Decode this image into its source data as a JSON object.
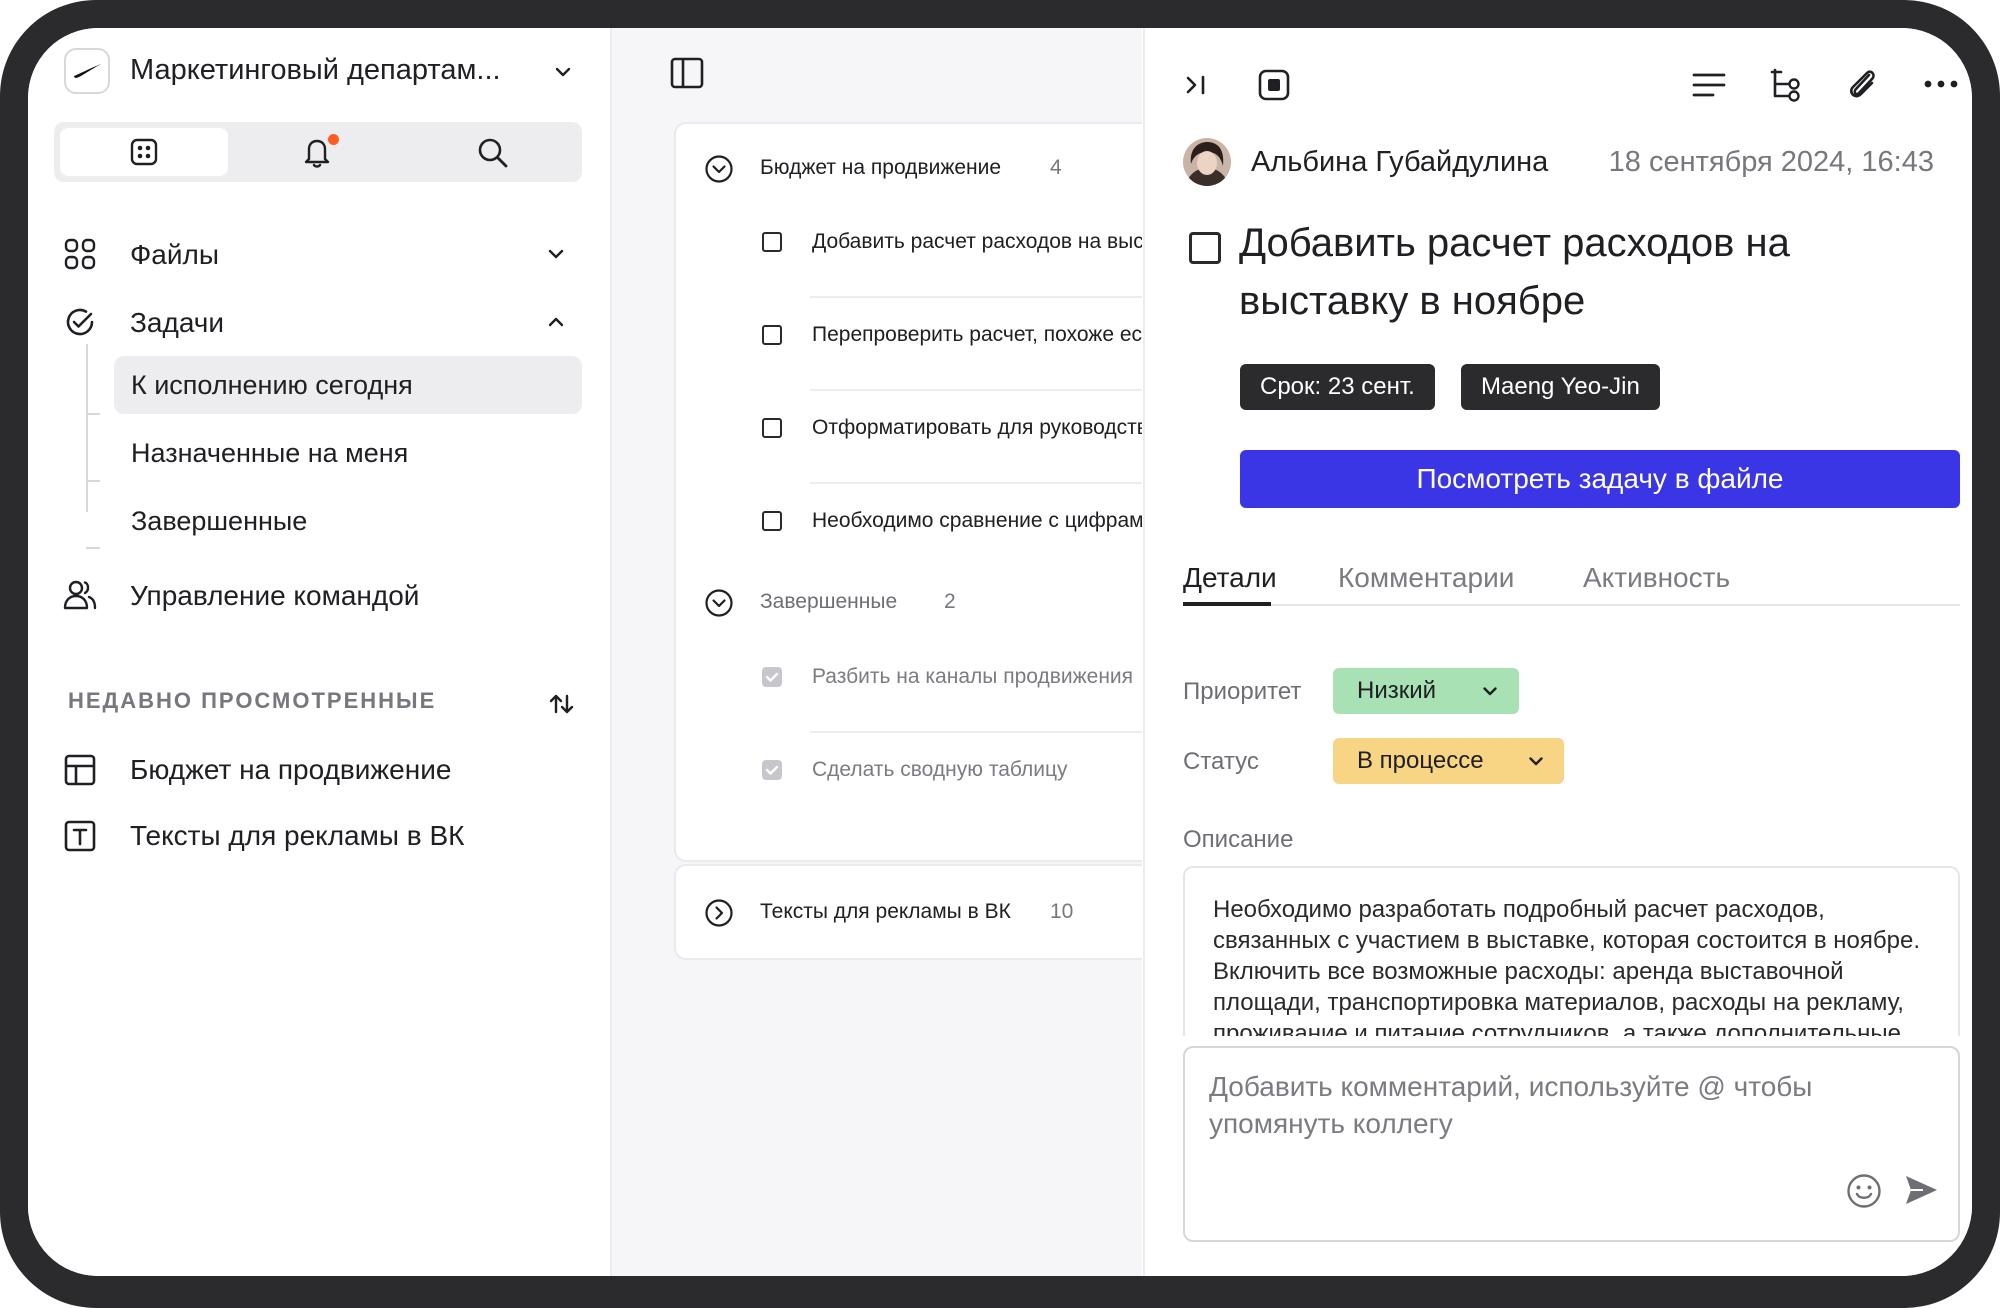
{
  "workspace": {
    "name": "Маркетинговый департам...",
    "logo": "swoosh-logo"
  },
  "tabs_switch": {
    "items": [
      "grid-icon",
      "bell-icon",
      "search-icon"
    ],
    "active": 0,
    "accent": "#ff5a1f"
  },
  "sidebar": {
    "files": "Файлы",
    "tasks": "Задачи",
    "task_subitems": [
      "К исполнению сегодня",
      "Назначенные на меня",
      "Завершенные"
    ],
    "team": "Управление командой",
    "recent_title": "НЕДАВНО ПРОСМОТРЕННЫЕ",
    "recent": [
      {
        "label": "Бюджет на продвижение",
        "icon": "table-icon"
      },
      {
        "label": "Тексты для рекламы в ВК",
        "icon": "text-doc-icon"
      }
    ]
  },
  "task_list": {
    "groups": [
      {
        "name": "Бюджет на продвижение",
        "count": "4",
        "expanded": true,
        "tasks": [
          "Добавить расчет расходов на выставку в ноябре",
          "Перепроверить расчет, похоже есть ошибка",
          "Отформатировать для руководства",
          "Необходимо сравнение с цифрами прошлого года"
        ]
      },
      {
        "name": "Завершенные",
        "count": "2",
        "expanded": true,
        "tasks": [
          "Разбить на каналы продвижения",
          "Сделать сводную таблицу"
        ]
      },
      {
        "name": "Тексты для рекламы в ВК",
        "count": "10",
        "expanded": false,
        "tasks": []
      }
    ]
  },
  "detail": {
    "author": "Альбина Губайдулина",
    "date": "18 сентября 2024, 16:43",
    "title": "Добавить расчет расходов на выставку в ноябре",
    "due_tag": "Срок: 23 сент.",
    "assignee_tag": "Maeng Yeo-Jin",
    "open_button": "Посмотреть задачу в файле",
    "tabs": [
      "Детали",
      "Комментарии",
      "Активность"
    ],
    "active_tab": 0,
    "priority_label": "Приоритет",
    "priority_value": "Низкий",
    "priority_color": "#a8e2b4",
    "status_label": "Статус",
    "status_value": "В процессе",
    "status_color": "#f8d485",
    "description_label": "Описание",
    "description": "Необходимо разработать подробный расчет расходов, связанных с участием в выставке, которая состоится в ноябре. Включить все возможные расходы: аренда выставочной площади, транспортировка материалов, расходы на рекламу, проживание и питание сотрудников, а также дополнительные расходы.",
    "comment_placeholder": "Добавить комментарий, используйте @ чтобы упомянуть коллегу"
  },
  "accent_color": "#3a36e6"
}
